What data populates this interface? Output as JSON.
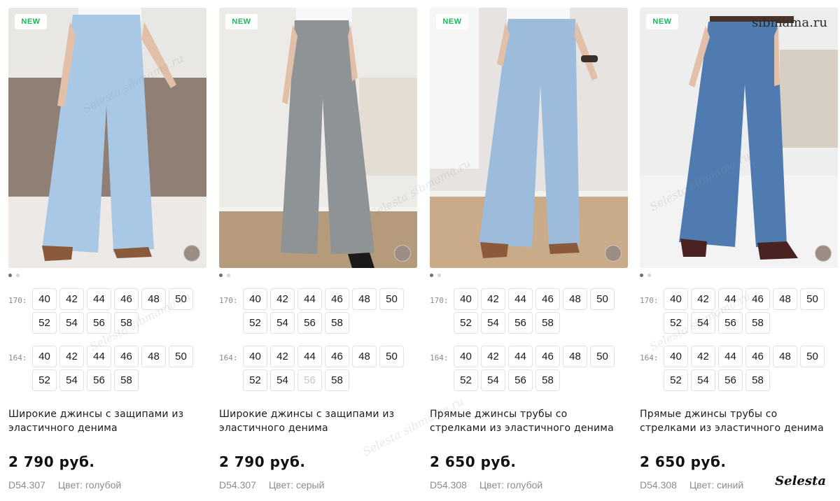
{
  "badge_label": "NEW",
  "heights": {
    "h170": "170:",
    "h164": "164:"
  },
  "products": [
    {
      "title_line1": "Широкие джинсы с защипами из",
      "title_line2": "эластичного денима",
      "price": "2 790 руб.",
      "sku": "D54.307",
      "color_label": "Цвет: голубой",
      "denim_color": "#a9c8e6",
      "sizes_170": [
        {
          "label": "40"
        },
        {
          "label": "42"
        },
        {
          "label": "44"
        },
        {
          "label": "46"
        },
        {
          "label": "48"
        },
        {
          "label": "50"
        },
        {
          "label": "52"
        },
        {
          "label": "54"
        },
        {
          "label": "56"
        },
        {
          "label": "58"
        }
      ],
      "sizes_164": [
        {
          "label": "40"
        },
        {
          "label": "42"
        },
        {
          "label": "44"
        },
        {
          "label": "46"
        },
        {
          "label": "48"
        },
        {
          "label": "50"
        },
        {
          "label": "52"
        },
        {
          "label": "54"
        },
        {
          "label": "56"
        },
        {
          "label": "58"
        }
      ]
    },
    {
      "title_line1": "Широкие джинсы с защипами из",
      "title_line2": "эластичного денима",
      "price": "2 790 руб.",
      "sku": "D54.307",
      "color_label": "Цвет: серый",
      "denim_color": "#8e9396",
      "sizes_170": [
        {
          "label": "40"
        },
        {
          "label": "42"
        },
        {
          "label": "44"
        },
        {
          "label": "46"
        },
        {
          "label": "48"
        },
        {
          "label": "50"
        },
        {
          "label": "52"
        },
        {
          "label": "54"
        },
        {
          "label": "56"
        },
        {
          "label": "58"
        }
      ],
      "sizes_164": [
        {
          "label": "40"
        },
        {
          "label": "42"
        },
        {
          "label": "44"
        },
        {
          "label": "46"
        },
        {
          "label": "48"
        },
        {
          "label": "50"
        },
        {
          "label": "52"
        },
        {
          "label": "54"
        },
        {
          "label": "56",
          "unavailable": true
        },
        {
          "label": "58"
        }
      ]
    },
    {
      "title_line1": "Прямые джинсы трубы со",
      "title_line2": "стрелками из эластичного денима",
      "price": "2 650 руб.",
      "sku": "D54.308",
      "color_label": "Цвет: голубой",
      "denim_color": "#9dbcdc",
      "sizes_170": [
        {
          "label": "40"
        },
        {
          "label": "42"
        },
        {
          "label": "44"
        },
        {
          "label": "46"
        },
        {
          "label": "48"
        },
        {
          "label": "50"
        },
        {
          "label": "52"
        },
        {
          "label": "54"
        },
        {
          "label": "56"
        },
        {
          "label": "58"
        }
      ],
      "sizes_164": [
        {
          "label": "40"
        },
        {
          "label": "42"
        },
        {
          "label": "44"
        },
        {
          "label": "46"
        },
        {
          "label": "48"
        },
        {
          "label": "50"
        },
        {
          "label": "52"
        },
        {
          "label": "54"
        },
        {
          "label": "56"
        },
        {
          "label": "58"
        }
      ]
    },
    {
      "title_line1": "Прямые джинсы трубы со",
      "title_line2": "стрелками из эластичного денима",
      "price": "2 650 руб.",
      "sku": "D54.308",
      "color_label": "Цвет: синий",
      "denim_color": "#4f7bb0",
      "sizes_170": [
        {
          "label": "40"
        },
        {
          "label": "42"
        },
        {
          "label": "44"
        },
        {
          "label": "46"
        },
        {
          "label": "48"
        },
        {
          "label": "50"
        },
        {
          "label": "52"
        },
        {
          "label": "54"
        },
        {
          "label": "56"
        },
        {
          "label": "58"
        }
      ],
      "sizes_164": [
        {
          "label": "40"
        },
        {
          "label": "42"
        },
        {
          "label": "44"
        },
        {
          "label": "46"
        },
        {
          "label": "48"
        },
        {
          "label": "50"
        },
        {
          "label": "52"
        },
        {
          "label": "54"
        },
        {
          "label": "56"
        },
        {
          "label": "58"
        }
      ]
    }
  ],
  "watermark_text": "Selesta  sibmama.ru",
  "site_mark": "sibmama.ru",
  "brand_mark": "Selesta",
  "colors": {
    "badge_green": "#1db85a",
    "price_text": "#111111",
    "meta_text": "#8c8c8c",
    "swatch": "#9b8c84"
  }
}
